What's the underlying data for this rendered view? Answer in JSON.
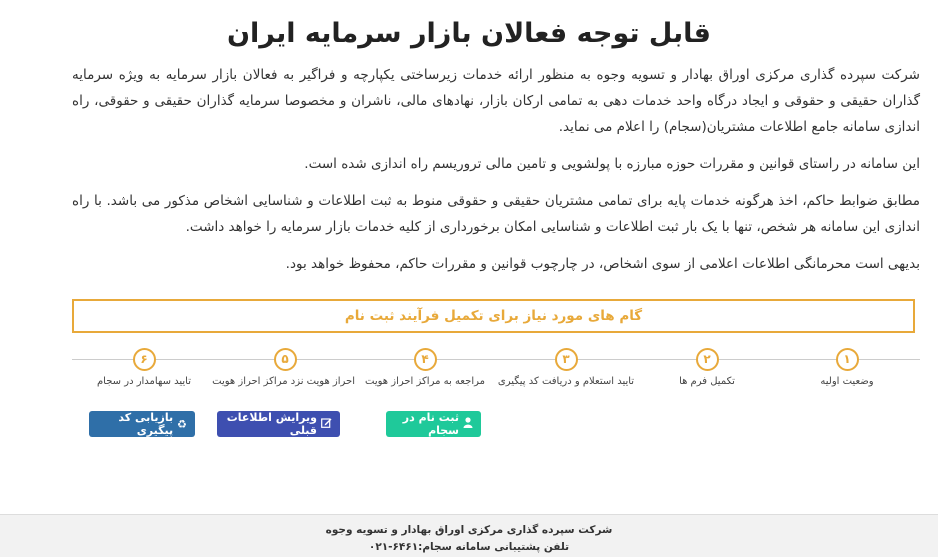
{
  "title": "قابل توجه فعالان بازار سرمایه ایران",
  "intro": {
    "p1": "شرکت سپرده گذاری مرکزی اوراق بهادار و تسویه وجوه به منظور ارائه خدمات زیرساختی یکپارچه و فراگیر به فعالان بازار سرمایه به ویژه سرمایه گذاران حقیقی و حقوقی و ایجاد درگاه واحد خدمات دهی به تمامی ارکان بازار، نهادهای مالی، ناشران و مخصوصا سرمایه گذاران حقیقی و حقوقی، راه اندازی سامانه جامع اطلاعات مشتریان(سجام) را اعلام می نماید.",
    "p2": "این سامانه در راستای قوانین و مقررات حوزه مبارزه با پولشویی و تامین مالی تروریسم راه اندازی شده است.",
    "p3": "مطابق ضوابط حاکم، اخذ هرگونه خدمات پایه برای تمامی مشتریان حقیقی و حقوقی منوط به ثبت اطلاعات و شناسایی اشخاص مذکور می باشد. با راه اندازی این سامانه هر شخص، تنها با یک بار ثبت اطلاعات و شناسایی امکان برخورداری از کلیه خدمات بازار سرمایه را خواهد داشت.",
    "p4": "بدیهی است محرمانگی اطلاعات اعلامی از سوی اشخاص، در چارچوب قوانین و مقررات حاکم، محفوظ خواهد بود."
  },
  "steps_heading": "گام های مورد نیاز برای تکمیل فرآیند ثبت نام",
  "steps": [
    {
      "num": "۱",
      "label": "وضعیت اولیه"
    },
    {
      "num": "۲",
      "label": "تکمیل فرم ها"
    },
    {
      "num": "۳",
      "label": "تایید استعلام و دریافت کد پیگیری"
    },
    {
      "num": "۴",
      "label": "مراجعه به مراکز احراز هویت"
    },
    {
      "num": "۵",
      "label": "احراز هویت نزد مراکز احراز هویت"
    },
    {
      "num": "۶",
      "label": "تایید سهامدار در سجام"
    }
  ],
  "buttons": {
    "register": {
      "label": "ثبت نام در سجام",
      "icon": "user-icon"
    },
    "edit": {
      "label": "ویرایش اطلاعات قبلی",
      "icon": "edit-icon"
    },
    "track": {
      "label": "بازیابی کد پیگیری",
      "icon": "recycle-icon"
    }
  },
  "footer": {
    "company": "شرکت سپرده گذاری مرکزی اوراق بهادار و تسویه وجوه",
    "phone": "تلفن پشتیبانی سامانه سجام:۶۴۶۱-۰۲۱"
  },
  "colors": {
    "accent": "#e8a93a",
    "register": "#1fc99a",
    "edit": "#3e4fb0",
    "track": "#2f6fa8"
  }
}
